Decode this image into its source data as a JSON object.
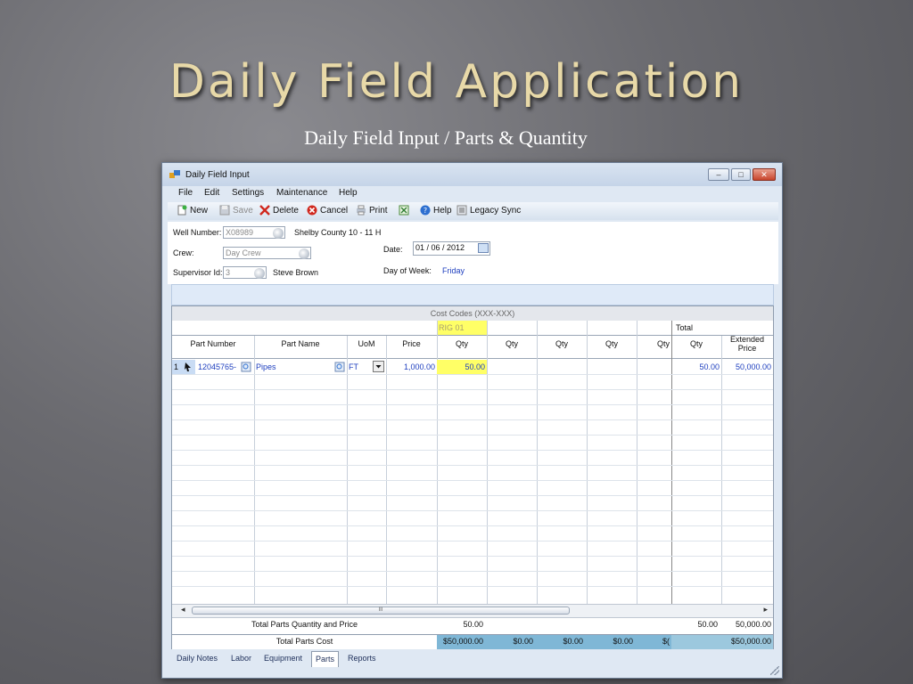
{
  "slide": {
    "title": "Daily Field Application",
    "subtitle": "Daily Field Input / Parts & Quantity"
  },
  "window": {
    "title": "Daily Field Input",
    "buttons": {
      "minimize": "‒",
      "maximize": "□",
      "close": "✕"
    }
  },
  "menu": [
    "File",
    "Edit",
    "Settings",
    "Maintenance",
    "Help"
  ],
  "toolbar": {
    "new": "New",
    "save": "Save",
    "delete": "Delete",
    "cancel": "Cancel",
    "print": "Print",
    "help": "Help",
    "legacy_sync": "Legacy Sync"
  },
  "form": {
    "well_number_label": "Well Number:",
    "well_number_value": "X08989",
    "well_name": "Shelby County 10 - 11 H",
    "crew_label": "Crew:",
    "crew_value": "Day Crew",
    "supervisor_label": "Supervisor Id:",
    "supervisor_value": "3",
    "supervisor_name": "Steve Brown",
    "date_label": "Date:",
    "date_value": "01 / 06 / 2012",
    "day_of_week_label": "Day of Week:",
    "day_of_week_value": "Friday"
  },
  "grid": {
    "cost_codes_label": "Cost Codes (XXX-XXX)",
    "cost_code_1": "RIG 01",
    "total_label": "Total",
    "headers": [
      "Part Number",
      "Part Name",
      "UoM",
      "Price",
      "Qty",
      "Qty",
      "Qty",
      "Qty",
      "Qty",
      "Qty",
      "Extended Price"
    ],
    "row": {
      "index": "1",
      "part_number": "12045765-",
      "part_name": "Pipes",
      "uom": "FT",
      "price": "1,000.00",
      "qty1": "50.00",
      "total_qty": "50.00",
      "extended_price": "50,000.00"
    },
    "scroll_left": "◂",
    "scroll_right": "▸",
    "scroll_thumb": "III"
  },
  "totals": {
    "qty_price_label": "Total Parts Quantity and Price",
    "qty1": "50.00",
    "total_qty": "50.00",
    "extended": "50,000.00",
    "cost_label": "Total Parts Cost",
    "cost1": "$50,000.00",
    "cost2": "$0.00",
    "cost3": "$0.00",
    "cost4": "$0.00",
    "cost5": "$(",
    "cost_total": "$50,000.00"
  },
  "tabs": [
    "Daily Notes",
    "Labor",
    "Equipment",
    "Parts",
    "Reports"
  ],
  "colors": {
    "highlight": "#ffff66",
    "accent_blue": "#1e3fbf",
    "total_row": "#7fb7d6"
  }
}
